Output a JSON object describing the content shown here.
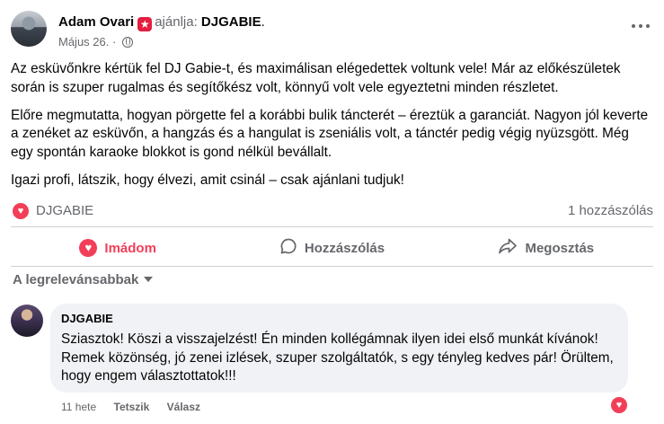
{
  "post": {
    "author": "Adam Ovari",
    "recommends_text": "ajánlja:",
    "page_name": "DJGABIE",
    "page_suffix": ".",
    "date": "Május 26.",
    "date_separator": "·",
    "paragraphs": [
      "Az esküvőnkre kértük fel DJ Gabie-t, és maximálisan elégedettek voltunk vele! Már az előkészületek során is szuper rugalmas és segítőkész volt, könnyű volt vele egyeztetni minden részletet.",
      "Előre megmutatta, hogyan pörgette fel a korábbi bulik táncterét – éreztük a garanciát. Nagyon jól keverte a zenéket az esküvőn, a hangzás és a hangulat is zseniális volt, a tánctér pedig végig nyüzsgött. Még egy spontán karaoke blokkot is gond nélkül bevállalt.",
      "Igazi profi, látszik, hogy élvezi, amit csinál – csak ajánlani tudjuk!"
    ],
    "reaction_name": "DJGABIE",
    "comment_count": "1 hozzászólás"
  },
  "actions": {
    "like": "Imádom",
    "comment": "Hozzászólás",
    "share": "Megosztás"
  },
  "sort": {
    "label": "A legrelevánsabbak"
  },
  "comment": {
    "author": "DJGABIE",
    "text": "Sziasztok! Köszi a visszajelzést! Én minden kollégámnak ilyen idei első munkát kívánok! Remek közönség, jó zenei izlések, szuper szolgáltatók, s egy tényleg kedves pár! Örültem, hogy engem választottatok!!!",
    "time": "11 hete",
    "like_label": "Tetszik",
    "reply_label": "Válasz"
  },
  "colors": {
    "accent_love": "#f33e58",
    "secondary_text": "#65676b",
    "bubble_bg": "#f0f2f5"
  }
}
